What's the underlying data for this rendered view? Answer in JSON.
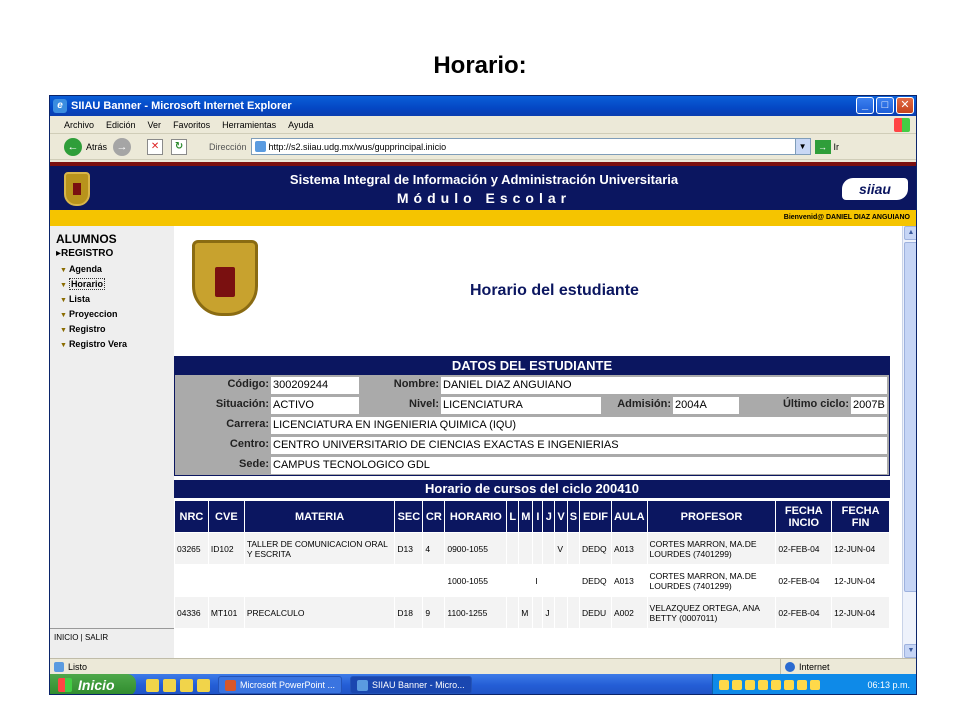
{
  "slide_title": "Horario:",
  "window": {
    "title": "SIIAU Banner - Microsoft Internet Explorer",
    "buttons": {
      "minimize": "_",
      "maximize": "□",
      "close": "✕"
    }
  },
  "menu": [
    "Archivo",
    "Edición",
    "Ver",
    "Favoritos",
    "Herramientas",
    "Ayuda"
  ],
  "toolbar": {
    "back_label": "Atrás",
    "address_label": "Dirección",
    "url": "http://s2.siiau.udg.mx/wus/gupprincipal.inicio",
    "go_label": "Ir"
  },
  "header": {
    "system_title": "Sistema Integral de Información y Administración Universitaria",
    "module": "Módulo Escolar",
    "logo_text": "siiau",
    "welcome": "Bienvenid@  DANIEL DIAZ ANGUIANO"
  },
  "sidebar": {
    "heading": "ALUMNOS",
    "section": "▸REGISTRO",
    "items": [
      {
        "label": "Agenda",
        "active": false
      },
      {
        "label": "Horario",
        "active": true
      },
      {
        "label": "Lista",
        "active": false
      },
      {
        "label": "Proyeccion",
        "active": false
      },
      {
        "label": "Registro",
        "active": false
      },
      {
        "label": "Registro Vera",
        "active": false
      }
    ],
    "footer": "INICIO | SALIR"
  },
  "page": {
    "heading": "Horario del estudiante",
    "datos_title": "DATOS DEL ESTUDIANTE",
    "labels": {
      "codigo": "Código:",
      "nombre": "Nombre:",
      "situacion": "Situación:",
      "nivel": "Nivel:",
      "admision": "Admisión:",
      "ultimo_ciclo": "Último ciclo:",
      "carrera": "Carrera:",
      "centro": "Centro:",
      "sede": "Sede:"
    },
    "values": {
      "codigo": "300209244",
      "nombre": "DANIEL DIAZ ANGUIANO",
      "situacion": "ACTIVO",
      "nivel": "LICENCIATURA",
      "admision": "2004A",
      "ultimo_ciclo": "2007B",
      "carrera": "LICENCIATURA EN INGENIERIA QUIMICA (IQU)",
      "centro": "CENTRO UNIVERSITARIO DE CIENCIAS EXACTAS E INGENIERIAS",
      "sede": "CAMPUS TECNOLOGICO GDL"
    },
    "horario_title": "Horario de cursos del ciclo 200410",
    "columns": [
      "NRC",
      "CVE",
      "MATERIA",
      "SEC",
      "CR",
      "HORARIO",
      "L",
      "M",
      "I",
      "J",
      "V",
      "S",
      "EDIF",
      "AULA",
      "PROFESOR",
      "FECHA INCIO",
      "FECHA FIN"
    ],
    "rows": [
      [
        "03265",
        "ID102",
        "TALLER DE COMUNICACION ORAL Y ESCRITA",
        "D13",
        "4",
        "0900-1055",
        "",
        "",
        "",
        "",
        "V",
        "",
        "DEDQ",
        "A013",
        "CORTES MARRON, MA.DE LOURDES (7401299)",
        "02-FEB-04",
        "12-JUN-04"
      ],
      [
        "",
        "",
        "",
        "",
        "",
        "1000-1055",
        "",
        "",
        "I",
        "",
        "",
        "",
        "DEDQ",
        "A013",
        "CORTES MARRON, MA.DE LOURDES (7401299)",
        "02-FEB-04",
        "12-JUN-04"
      ],
      [
        "04336",
        "MT101",
        "PRECALCULO",
        "D18",
        "9",
        "1100-1255",
        "",
        "M",
        "",
        "J",
        "",
        "",
        "DEDU",
        "A002",
        "VELAZQUEZ ORTEGA, ANA BETTY (0007011)",
        "02-FEB-04",
        "12-JUN-04"
      ]
    ]
  },
  "status": {
    "left": "Listo",
    "zone": "Internet"
  },
  "taskbar": {
    "start": "Inicio",
    "tasks": [
      {
        "label": "Microsoft PowerPoint ...",
        "icon": "powerpoint-icon"
      },
      {
        "label": "SIIAU Banner - Micro...",
        "icon": "ie-icon"
      }
    ],
    "clock": "06:13 p.m."
  },
  "colors": {
    "navy": "#0b1660",
    "gold": "#f5c400",
    "maroon": "#7a1010"
  }
}
